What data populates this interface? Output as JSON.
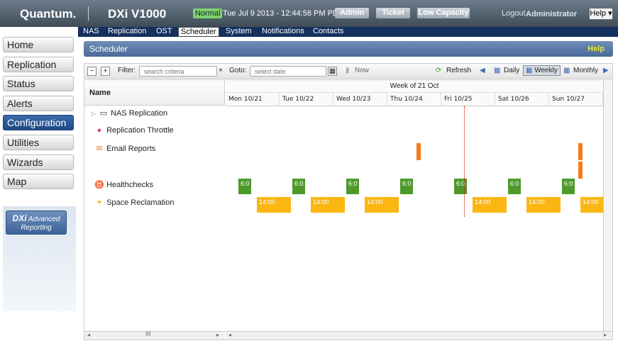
{
  "header": {
    "logo": "Quantum.",
    "product": "DXi V1000",
    "status": "Normal",
    "datetime": "Tue Jul 9 2013 - 12:44:58 PM PDT",
    "buttons": {
      "admin": "Admin",
      "ticket": "Ticket",
      "low_capacity": "Low Capacity"
    },
    "logout": "Logout",
    "user": "Administrator",
    "help": "Help ▾"
  },
  "nav": {
    "tabs": [
      "NAS",
      "Replication",
      "OST",
      "Scheduler",
      "System",
      "Notifications",
      "Contacts"
    ],
    "active": "Scheduler"
  },
  "sidebar": {
    "items": [
      "Home",
      "Replication",
      "Status",
      "Alerts",
      "Configuration",
      "Utilities",
      "Wizards",
      "Map"
    ],
    "active": "Configuration",
    "reporting": {
      "brand": "DXi",
      "label1": "Advanced",
      "label2": "Reporting"
    }
  },
  "page": {
    "title": "Scheduler",
    "help": "Help"
  },
  "toolbar": {
    "filter_label": "Filter:",
    "filter_placeholder": "search criteria",
    "goto_label": "Goto:",
    "goto_placeholder": "select date",
    "now": "Now",
    "refresh": "Refresh",
    "daily": "Daily",
    "weekly": "Weekly",
    "monthly": "Monthly"
  },
  "grid": {
    "name_header": "Name",
    "week_label": "Week of 21 Oct",
    "days": [
      "Mon 10/21",
      "Tue 10/22",
      "Wed 10/23",
      "Thu 10/24",
      "Fri 10/25",
      "Sat 10/26",
      "Sun 10/27"
    ],
    "rows": [
      {
        "label": "NAS Replication",
        "icon": "folder-icon"
      },
      {
        "label": "Replication Throttle",
        "icon": "throttle-icon"
      },
      {
        "label": "Email Reports",
        "icon": "email-icon"
      },
      {
        "label": "Healthchecks",
        "icon": "stethoscope-icon"
      },
      {
        "label": "Space Reclamation",
        "icon": "broom-icon"
      }
    ],
    "health_time": "6:0",
    "reclaim_time": "14:00"
  },
  "colors": {
    "health": "#4d9a2a",
    "reclaim": "#fbb611",
    "email": "#f37c1a",
    "nav": "#14305d"
  }
}
